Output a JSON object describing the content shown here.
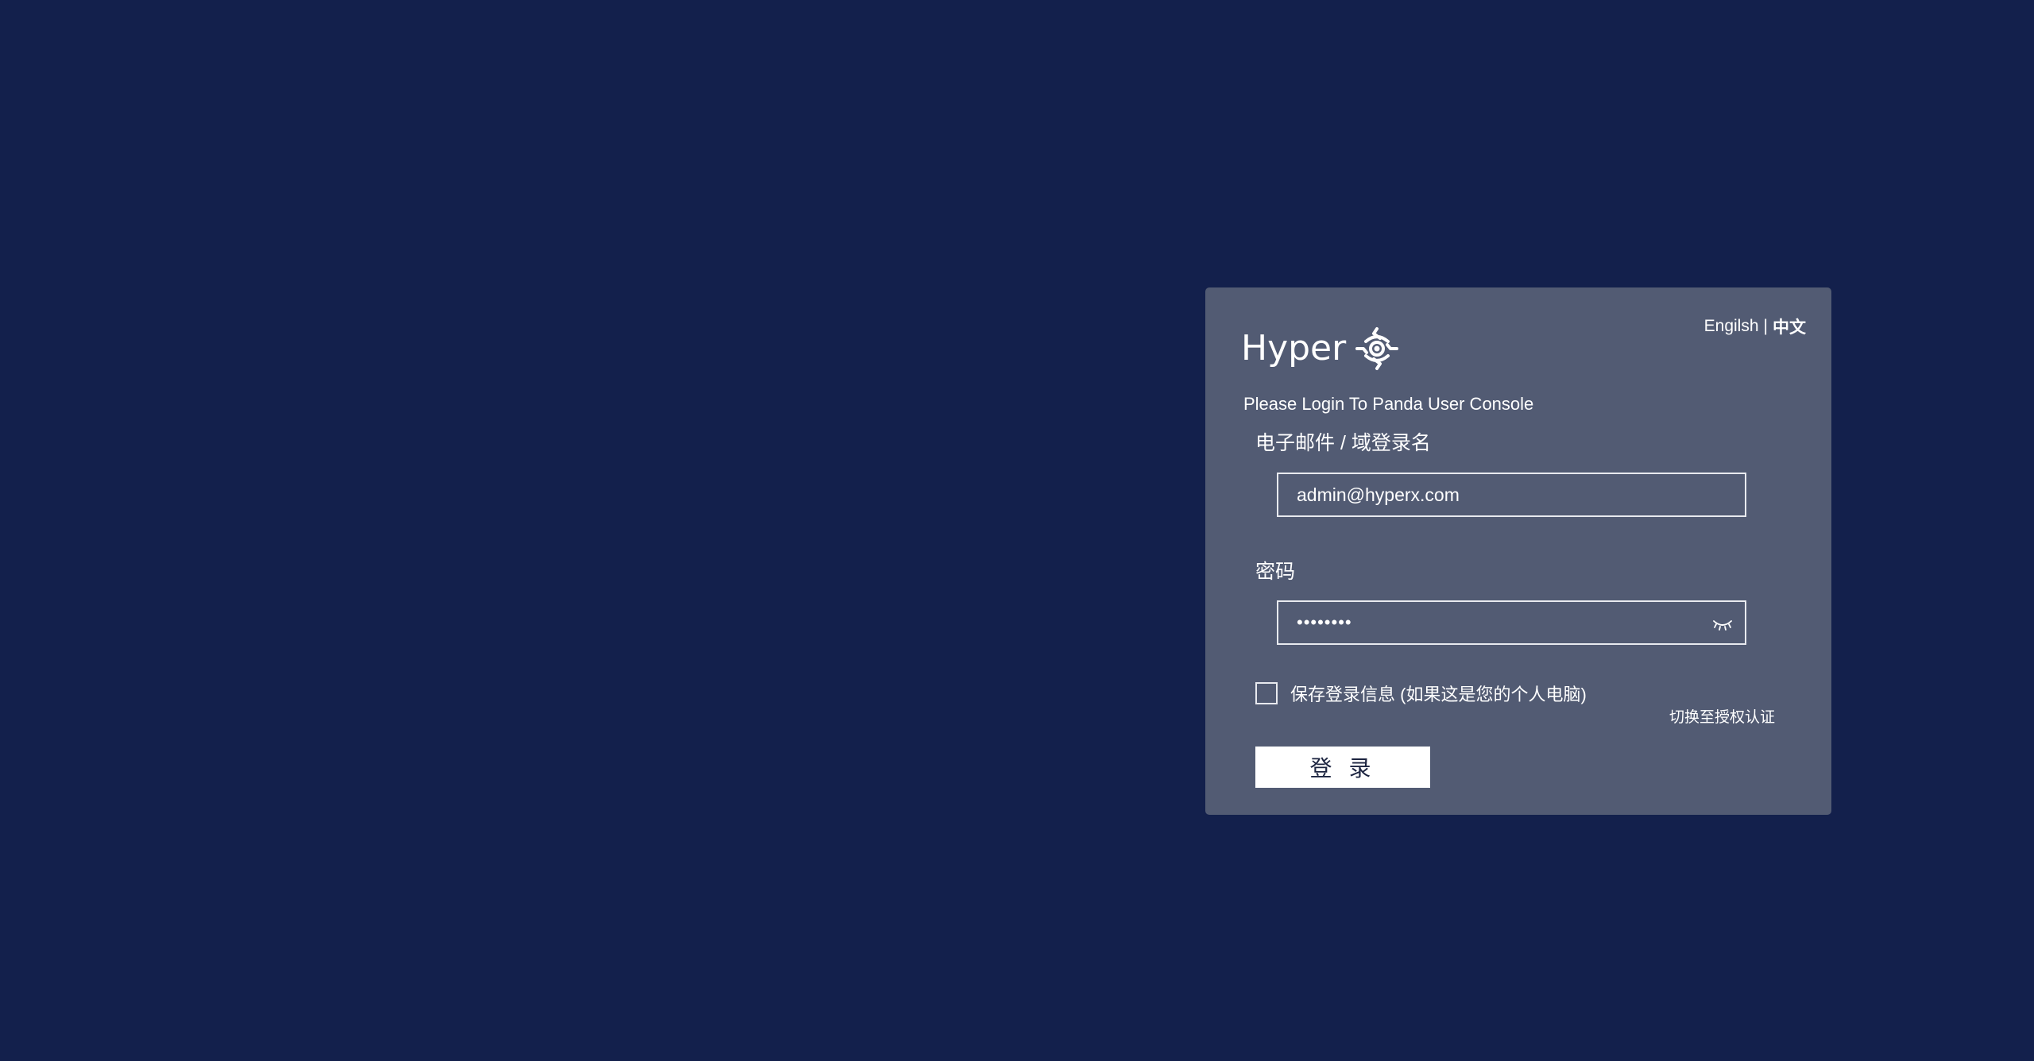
{
  "brand": {
    "logo_text": "Hyper"
  },
  "language": {
    "english": "Engilsh",
    "separator": "|",
    "chinese": "中文",
    "active": "中文"
  },
  "login": {
    "subtitle": "Please Login To Panda User Console",
    "email_label": "电子邮件 / 域登录名",
    "email_value": "admin@hyperx.com",
    "password_label": "密码",
    "password_value": "••••••••",
    "remember_label": "保存登录信息 (如果这是您的个人电脑)",
    "remember_checked": false,
    "switch_auth": "切换至授权认证",
    "submit_label": "登 录"
  },
  "colors": {
    "background": "#13204c",
    "card": "#525b73",
    "button": "#ffffff",
    "text": "#ffffff"
  },
  "icons": {
    "logo_mark": "hyper-logo-icon",
    "password_toggle": "eye-closed-icon"
  }
}
